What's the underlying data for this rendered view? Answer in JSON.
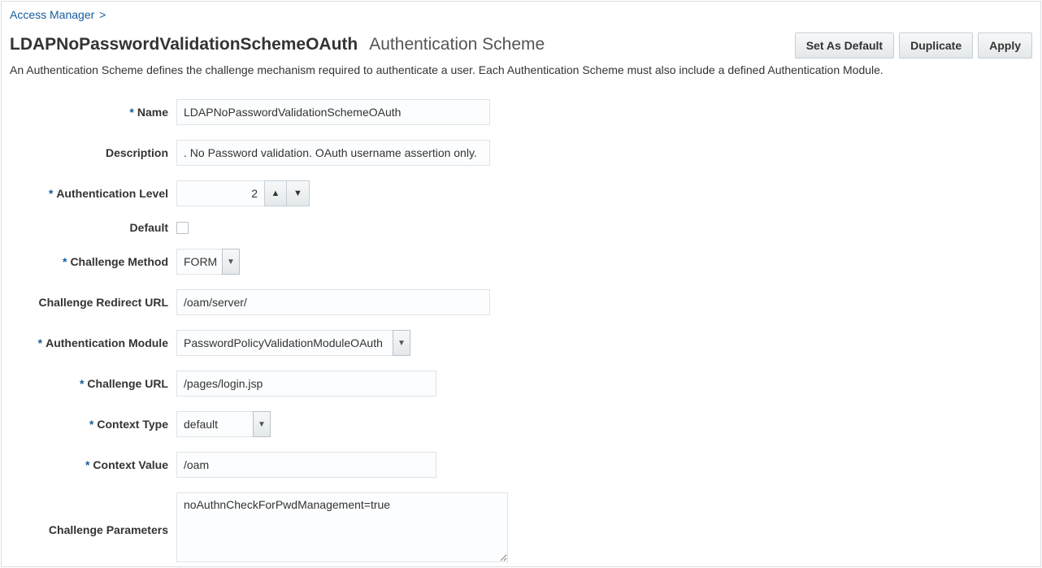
{
  "breadcrumb": {
    "root": "Access Manager",
    "sep": ">"
  },
  "header": {
    "title": "LDAPNoPasswordValidationSchemeOAuth",
    "subtitle": "Authentication Scheme"
  },
  "buttons": {
    "set_default": "Set As Default",
    "duplicate": "Duplicate",
    "apply": "Apply"
  },
  "description": "An Authentication Scheme defines the challenge mechanism required to authenticate a user. Each Authentication Scheme must also include a defined Authentication Module.",
  "labels": {
    "name": "Name",
    "desc": "Description",
    "auth_level": "Authentication Level",
    "default": "Default",
    "challenge_method": "Challenge Method",
    "challenge_redirect_url": "Challenge Redirect URL",
    "auth_module": "Authentication Module",
    "challenge_url": "Challenge URL",
    "context_type": "Context Type",
    "context_value": "Context Value",
    "challenge_params": "Challenge Parameters"
  },
  "values": {
    "name": "LDAPNoPasswordValidationSchemeOAuth",
    "desc": ". No Password validation. OAuth username assertion only.",
    "auth_level": "2",
    "default_checked": false,
    "challenge_method": "FORM",
    "challenge_redirect_url": "/oam/server/",
    "auth_module": "PasswordPolicyValidationModuleOAuth",
    "challenge_url": "/pages/login.jsp",
    "context_type": "default",
    "context_value": "/oam",
    "challenge_params": "noAuthnCheckForPwdManagement=true"
  }
}
